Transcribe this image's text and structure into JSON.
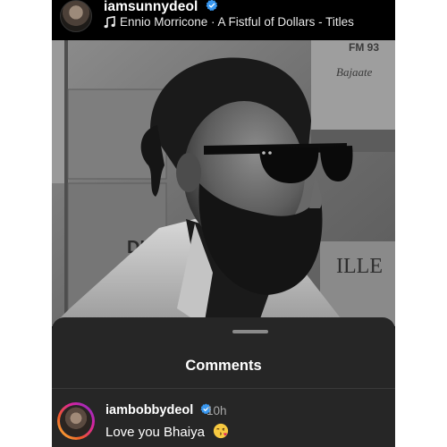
{
  "post": {
    "username": "iamsunnydeol",
    "music_icon": "music-note-icon",
    "song": "Ennio Morricone · A Fistful of Dollars - Titles"
  },
  "backdrop": {
    "sign_top": "FM 93",
    "sign_script": "Bajaate",
    "sign_left": "DI",
    "sign_right": "ILLE"
  },
  "comments": {
    "title": "Comments",
    "items": [
      {
        "username": "iambobbydeol",
        "time": "10h",
        "text": "Love you Bhaiya",
        "emoji_icon": "kissing-heart-emoji-icon"
      }
    ]
  },
  "colors": {
    "verified_blue": "#3897f0",
    "sheet_bg": "#262626",
    "header_bg": "#000000"
  }
}
